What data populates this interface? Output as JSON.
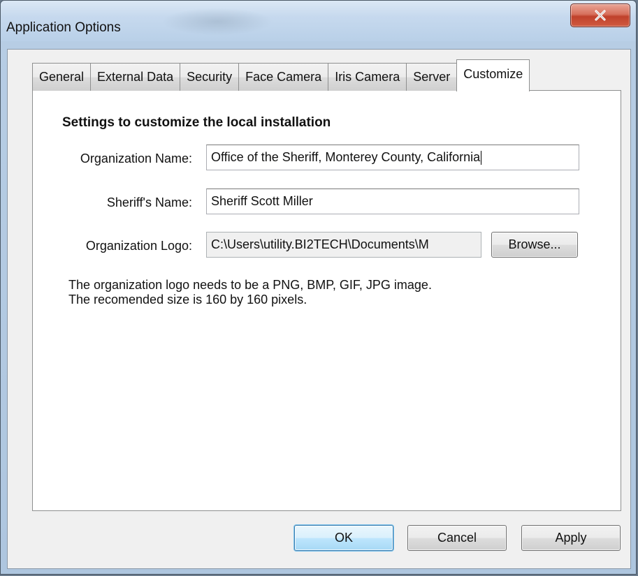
{
  "window": {
    "title": "Application Options",
    "close_glyph": "close-icon"
  },
  "tabs": [
    {
      "label": "General",
      "active": false
    },
    {
      "label": "External Data",
      "active": false
    },
    {
      "label": "Security",
      "active": false
    },
    {
      "label": "Face Camera",
      "active": false
    },
    {
      "label": "Iris Camera",
      "active": false
    },
    {
      "label": "Server",
      "active": false
    },
    {
      "label": "Customize",
      "active": true
    }
  ],
  "customize": {
    "heading": "Settings to customize the local installation",
    "org_name_label": "Organization Name:",
    "org_name_value": "Office of the Sheriff, Monterey County, California",
    "sheriff_name_label": "Sheriff's Name:",
    "sheriff_name_value": "Sheriff Scott Miller",
    "org_logo_label": "Organization Logo:",
    "org_logo_value": "C:\\Users\\utility.BI2TECH\\Documents\\M",
    "browse_label": "Browse...",
    "info_line1": "The organization logo needs to be a PNG, BMP, GIF, JPG image.",
    "info_line2": "The recomended size is 160 by 160 pixels."
  },
  "footer": {
    "ok_label": "OK",
    "cancel_label": "Cancel",
    "apply_label": "Apply"
  },
  "colors": {
    "close_button": "#c7432c",
    "default_button_border": "#3c7fb1"
  }
}
